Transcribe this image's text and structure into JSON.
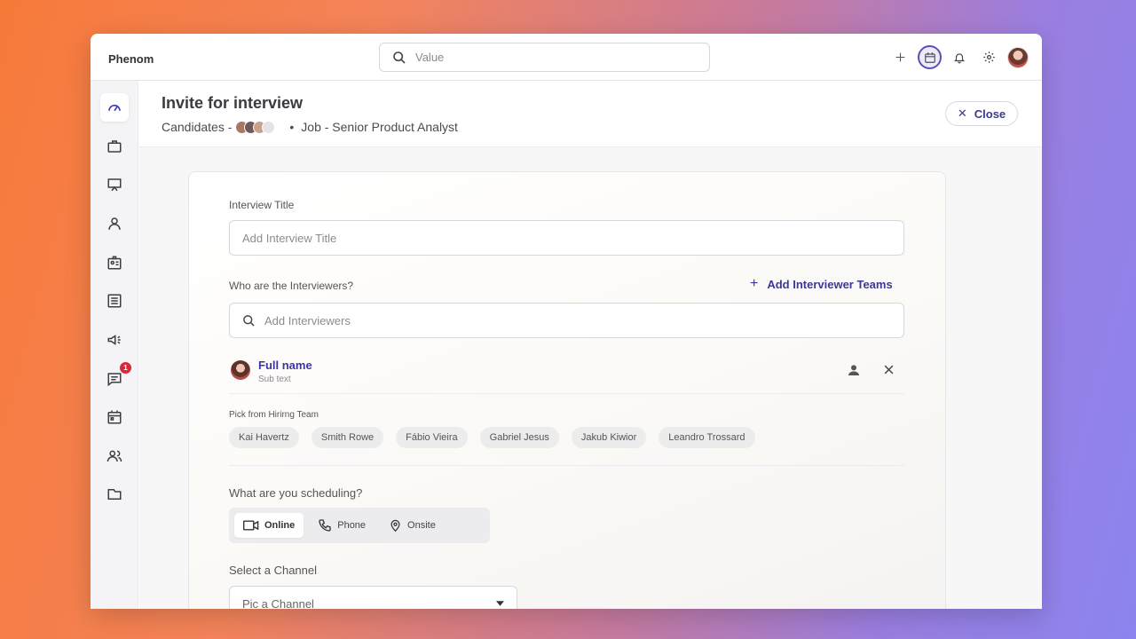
{
  "app": {
    "brand": "Phenom"
  },
  "search": {
    "placeholder": "Value"
  },
  "header": {
    "title": "Invite for interview",
    "candidates_label": "Candidates -",
    "job_label": "Job - Senior Product Analyst",
    "separator": "•",
    "close_label": "Close"
  },
  "form": {
    "interview_title_label": "Interview Title",
    "interview_title_placeholder": "Add Interview Title",
    "interviewers_label": "Who are the Interviewers?",
    "add_teams_label": "Add Interviewer Teams",
    "interviewers_placeholder": "Add Interviewers",
    "selected_person": {
      "name": "Full name",
      "sub": "Sub text"
    },
    "hiring_team_label": "Pick from Hirirng Team",
    "hiring_team": [
      "Kai Havertz",
      "Smith Rowe",
      "Fábio Vieira",
      "Gabriel Jesus",
      "Jakub Kiwior",
      "Leandro Trossard"
    ],
    "scheduling_label": "What are you scheduling?",
    "scheduling_options": [
      {
        "label": "Online",
        "icon": "video-icon"
      },
      {
        "label": "Phone",
        "icon": "phone-icon"
      },
      {
        "label": "Onsite",
        "icon": "location-pin-icon"
      }
    ],
    "scheduling_selected": "Online",
    "channel_label": "Select a Channel",
    "channel_placeholder": "Pic a Channel"
  },
  "sidebar": {
    "active": "dashboard",
    "items": [
      "dashboard-icon",
      "briefcase-icon",
      "presentation-icon",
      "person-icon",
      "id-card-icon",
      "list-icon",
      "megaphone-icon",
      "chat-icon",
      "calendar-icon",
      "people-icon",
      "folder-icon"
    ],
    "chat_badge": "1"
  },
  "colors": {
    "accent": "#3b3896",
    "badge": "#d8283a"
  }
}
